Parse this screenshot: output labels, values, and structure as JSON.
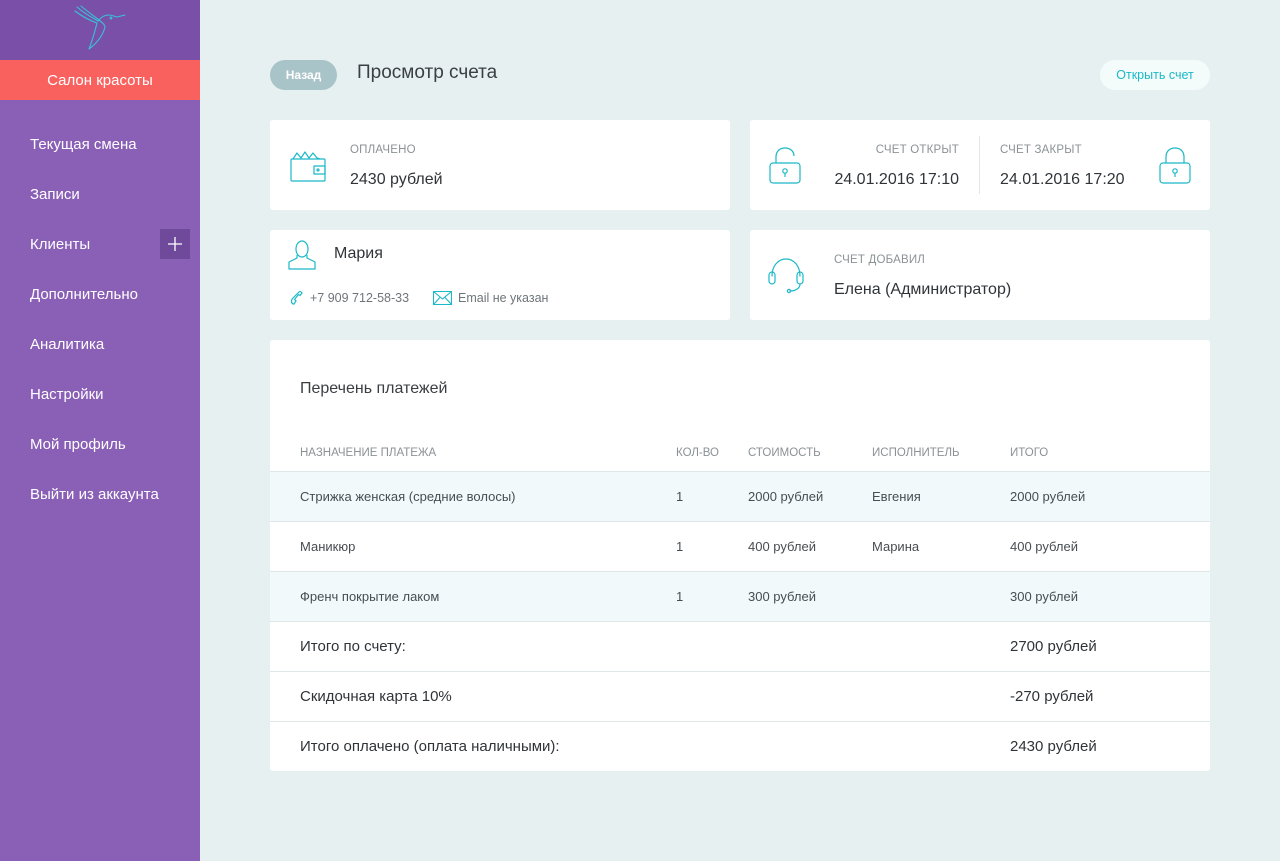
{
  "sidebar": {
    "logo_icon": "hummingbird-icon",
    "salon_label": "Салон красоты",
    "items": [
      {
        "label": "Текущая смена"
      },
      {
        "label": "Записи"
      },
      {
        "label": "Клиенты",
        "action_icon": "plus-icon"
      },
      {
        "label": "Дополнительно"
      },
      {
        "label": "Аналитика"
      },
      {
        "label": "Настройки"
      },
      {
        "label": "Мой профиль"
      },
      {
        "label": "Выйти из аккаунта"
      }
    ]
  },
  "header": {
    "back_label": "Назад",
    "title": "Просмотр счета",
    "open_label": "Открыть счет"
  },
  "paid": {
    "icon": "wallet-icon",
    "label": "ОПЛАЧЕНО",
    "value": "2430 рублей"
  },
  "status": {
    "opened_icon": "lock-open-icon",
    "closed_icon": "lock-closed-icon",
    "opened_label": "СЧЕТ ОТКРЫТ",
    "opened_value": "24.01.2016 17:10",
    "closed_label": "СЧЕТ ЗАКРЫТ",
    "closed_value": "24.01.2016 17:20"
  },
  "client": {
    "icon": "user-icon",
    "name": "Мария",
    "phone": "+7 909 712-58-33",
    "email": "Email не указан"
  },
  "added_by": {
    "icon": "headset-icon",
    "label": "СЧЕТ ДОБАВИЛ",
    "value": "Елена (Администратор)"
  },
  "payments": {
    "title": "Перечень платежей",
    "columns": [
      "НАЗНАЧЕНИЕ ПЛАТЕЖА",
      "КОЛ-ВО",
      "СТОИМОСТЬ",
      "ИСПОЛНИТЕЛЬ",
      "ИТОГО"
    ],
    "rows": [
      [
        "Стрижка женская (средние волосы)",
        "1",
        "2000 рублей",
        "Евгения",
        "2000 рублей"
      ],
      [
        "Маникюр",
        "1",
        "400 рублей",
        "Марина",
        "400 рублей"
      ],
      [
        "Френч покрытие лаком",
        "1",
        "300 рублей",
        "",
        "300 рублей"
      ]
    ],
    "summary": [
      {
        "label": "Итого по счету:",
        "value": "2700 рублей"
      },
      {
        "label": "Скидочная карта 10%",
        "value": "-270 рублей"
      },
      {
        "label": "Итого оплачено (оплата наличными):",
        "value": "2430 рублей"
      }
    ]
  },
  "colors": {
    "sidebar": "#8a5fb6",
    "sidebar_top": "#7a4fa8",
    "salon": "#f9615e",
    "accent": "#1bb8c7",
    "background": "#e6f0f1"
  }
}
